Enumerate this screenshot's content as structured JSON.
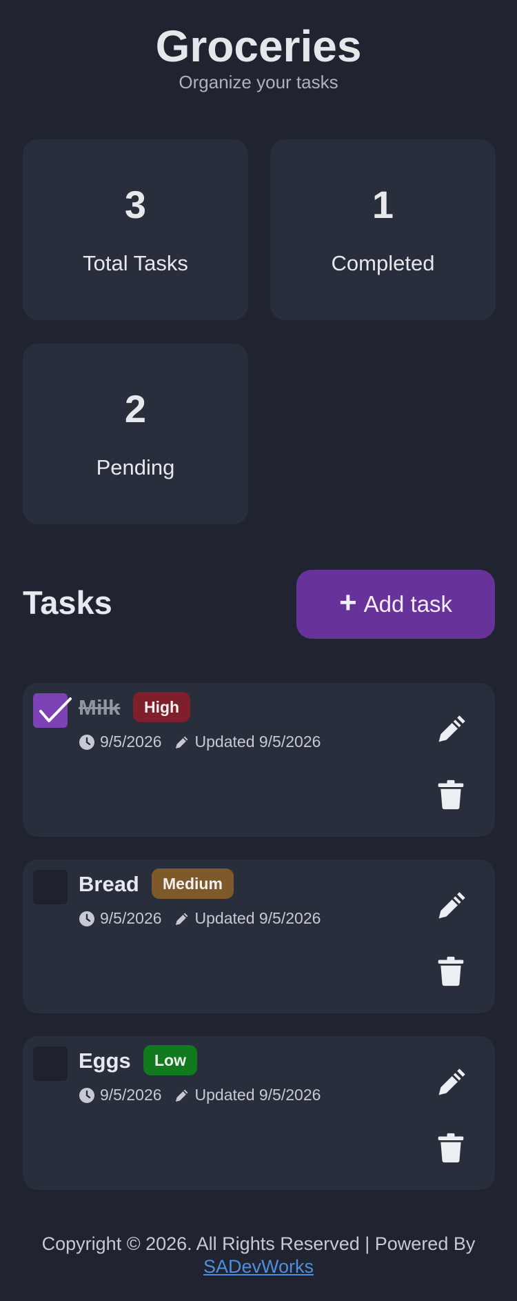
{
  "header": {
    "title": "Groceries",
    "subtitle": "Organize your tasks"
  },
  "stats": [
    {
      "value": "3",
      "label": "Total Tasks"
    },
    {
      "value": "1",
      "label": "Completed"
    },
    {
      "value": "2",
      "label": "Pending"
    }
  ],
  "tasks_section": {
    "title": "Tasks",
    "add_button_label": "Add task",
    "add_button_icon": "plus-icon"
  },
  "tasks": [
    {
      "name": "Milk",
      "completed": true,
      "priority": "High",
      "priority_color": "#7e1f2b",
      "date": "9/5/2026",
      "updated": "Updated 9/5/2026"
    },
    {
      "name": "Bread",
      "completed": false,
      "priority": "Medium",
      "priority_color": "#7e5a2a",
      "date": "9/5/2026",
      "updated": "Updated 9/5/2026"
    },
    {
      "name": "Eggs",
      "completed": false,
      "priority": "Low",
      "priority_color": "#117a1e",
      "date": "9/5/2026",
      "updated": "Updated 9/5/2026"
    }
  ],
  "icons": {
    "date": "clock-icon",
    "updated": "pencil-icon",
    "edit": "edit-icon",
    "delete": "trash-icon",
    "check": "check-icon"
  },
  "colors": {
    "background": "#1f2430",
    "card": "#282e3b",
    "accent": "#67339a",
    "checked": "#7d42b6",
    "link": "#4e8fe0"
  },
  "footer": {
    "text": "Copyright © 2026. All Rights Reserved | Powered By",
    "link_label": "SADevWorks"
  }
}
